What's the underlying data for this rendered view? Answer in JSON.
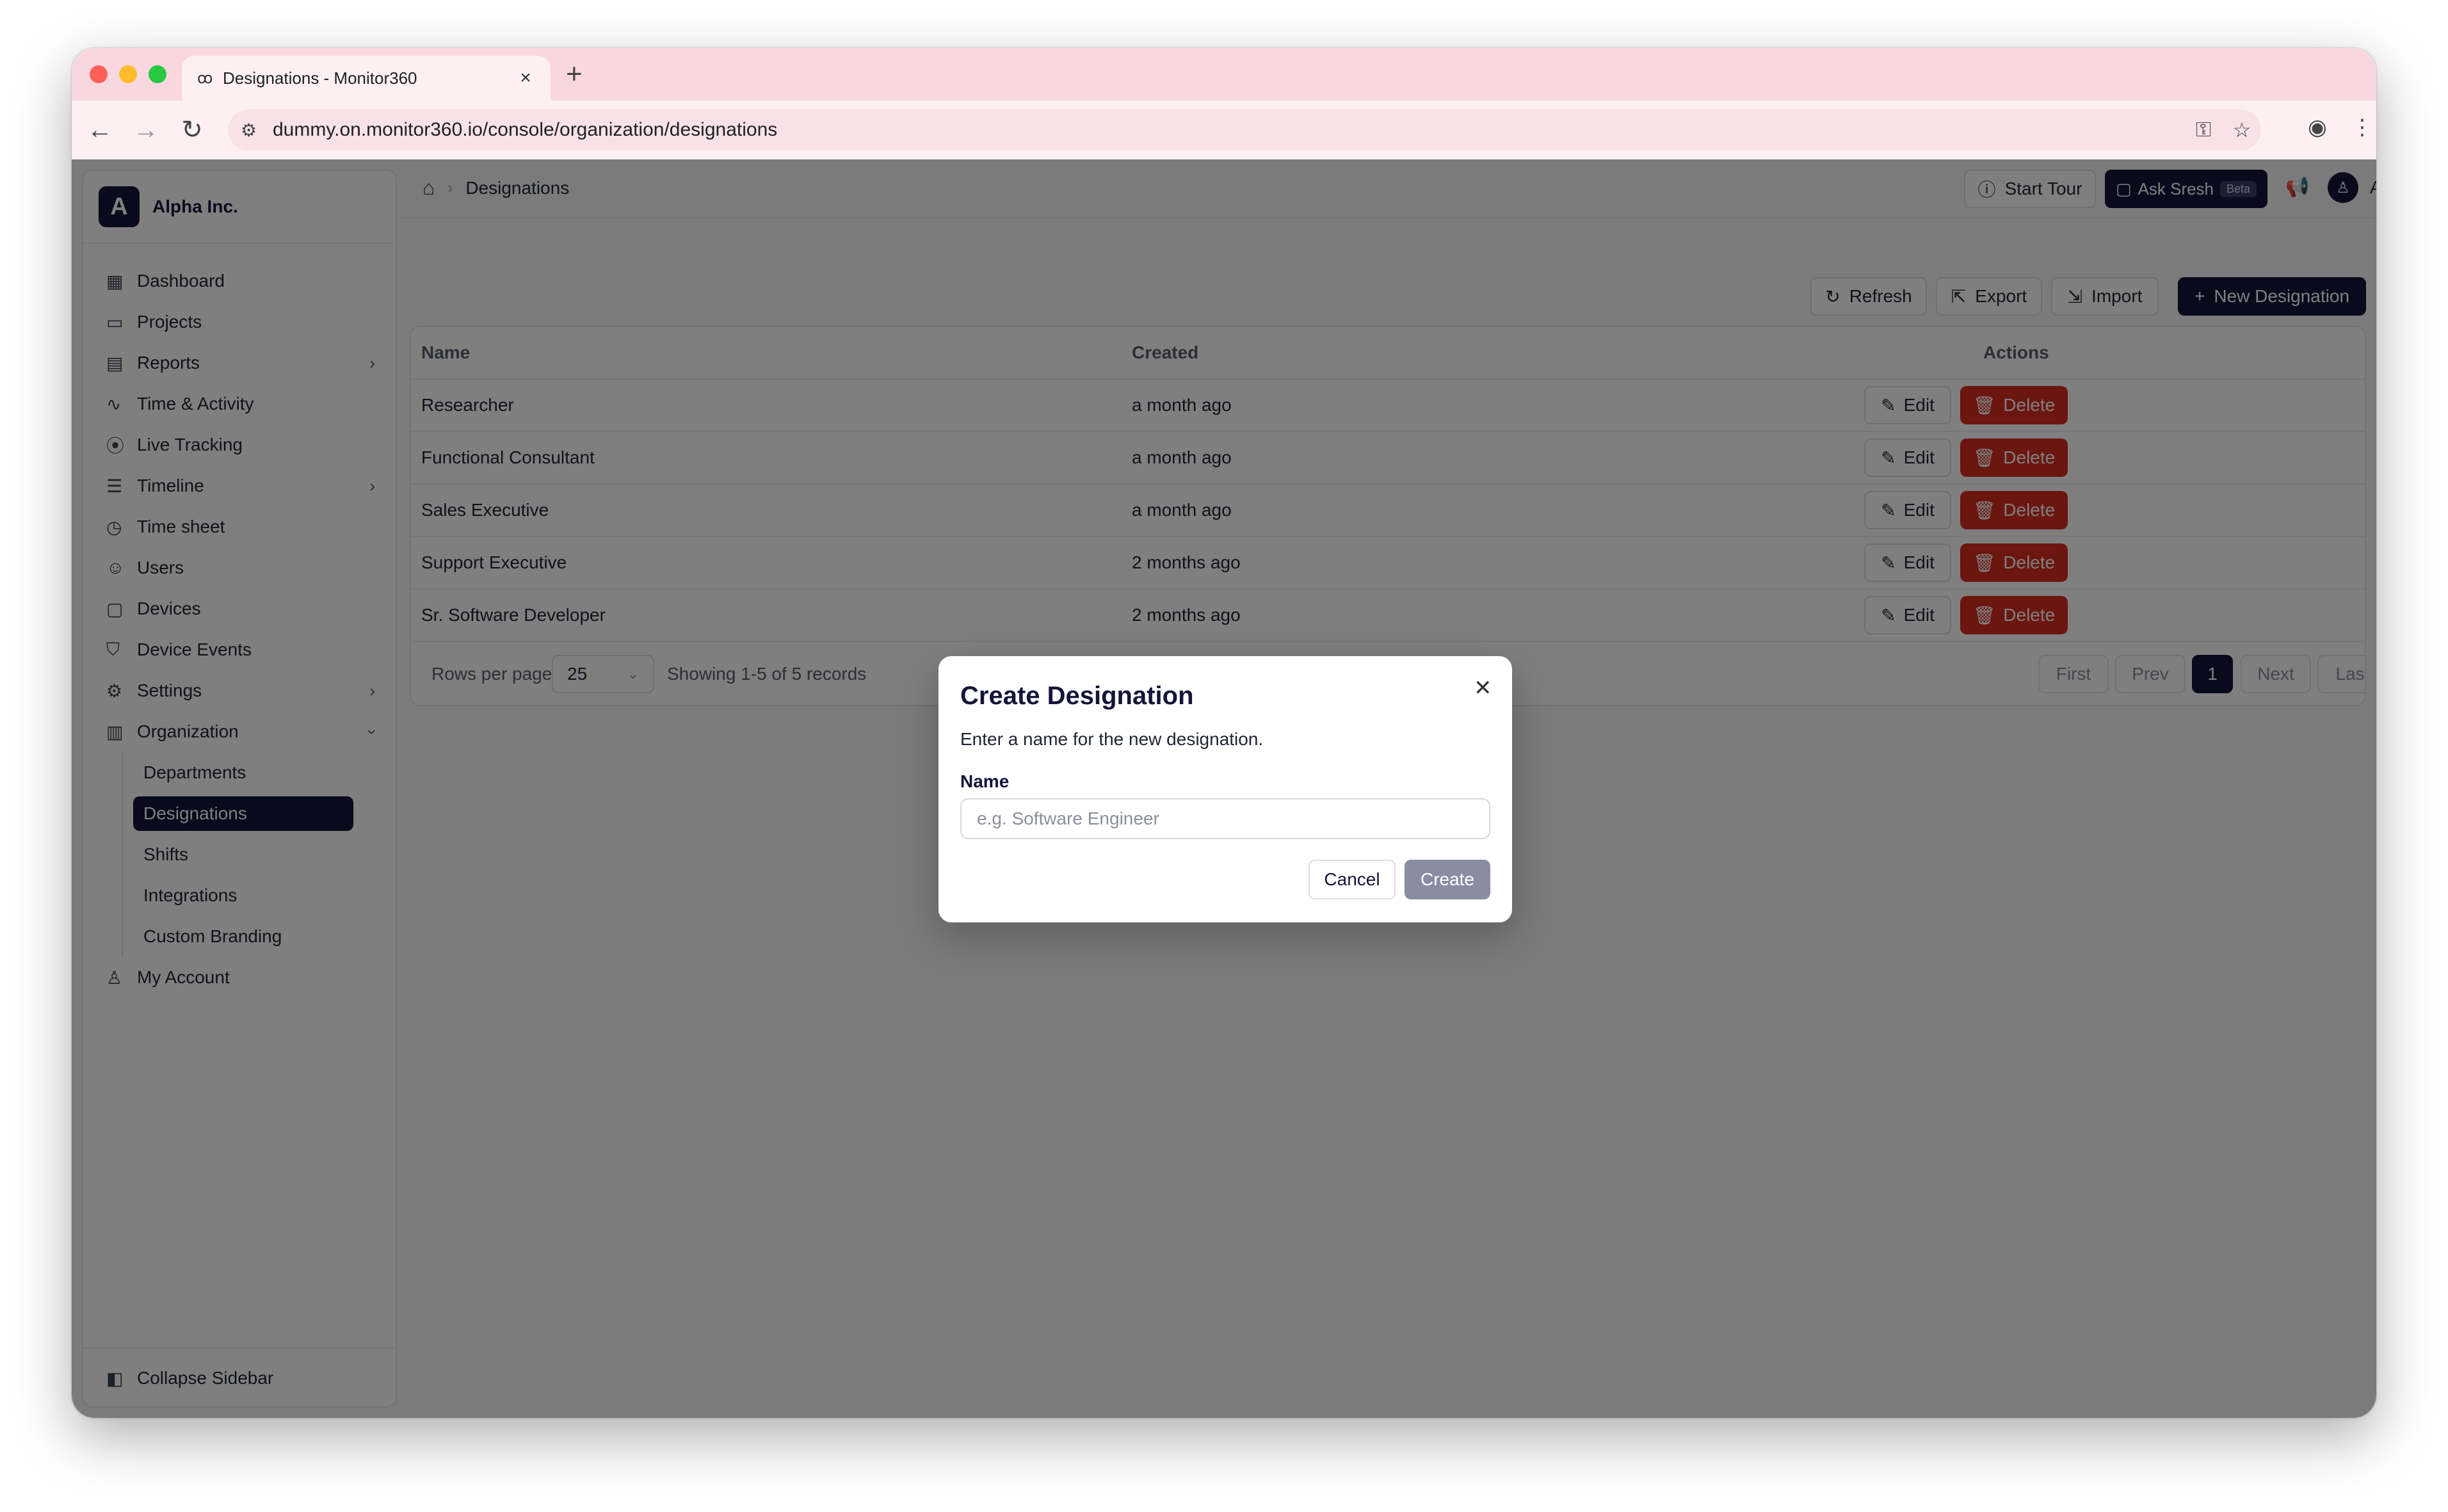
{
  "browser": {
    "tab_title": "Designations - Monitor360",
    "url": "dummy.on.monitor360.io/console/organization/designations"
  },
  "org": {
    "initial": "A",
    "name": "Alpha Inc."
  },
  "sidebar": {
    "items": [
      {
        "label": "Dashboard",
        "icon": "grid-icon"
      },
      {
        "label": "Projects",
        "icon": "folder-icon"
      },
      {
        "label": "Reports",
        "icon": "report-icon",
        "expandable": true
      },
      {
        "label": "Time & Activity",
        "icon": "activity-icon"
      },
      {
        "label": "Live Tracking",
        "icon": "radio-icon"
      },
      {
        "label": "Timeline",
        "icon": "timeline-icon",
        "expandable": true
      },
      {
        "label": "Time sheet",
        "icon": "timer-icon"
      },
      {
        "label": "Users",
        "icon": "users-icon"
      },
      {
        "label": "Devices",
        "icon": "monitor-icon"
      },
      {
        "label": "Device Events",
        "icon": "shield-icon"
      },
      {
        "label": "Settings",
        "icon": "gear-icon",
        "expandable": true
      },
      {
        "label": "Organization",
        "icon": "building-icon",
        "expanded": true
      }
    ],
    "org_sub_items": [
      "Departments",
      "Designations",
      "Shifts",
      "Integrations",
      "Custom Branding"
    ],
    "active_sub_item": "Designations",
    "my_account": "My Account",
    "collapse": "Collapse Sidebar"
  },
  "header": {
    "breadcrumb": "Designations",
    "start_tour": "Start Tour",
    "ask": "Ask Sresh",
    "beta": "Beta",
    "user": "Admin"
  },
  "toolbar": {
    "refresh": "Refresh",
    "export": "Export",
    "import": "Import",
    "new": "New Designation"
  },
  "table": {
    "columns": [
      "Name",
      "Created",
      "Actions"
    ],
    "rows": [
      {
        "name": "Researcher",
        "created": "a month ago"
      },
      {
        "name": "Functional Consultant",
        "created": "a month ago"
      },
      {
        "name": "Sales Executive",
        "created": "a month ago"
      },
      {
        "name": "Support Executive",
        "created": "2 months ago"
      },
      {
        "name": "Sr. Software Developer",
        "created": "2 months ago"
      }
    ],
    "edit_label": "Edit",
    "delete_label": "Delete"
  },
  "pagination": {
    "rows_per_page_label": "Rows per page",
    "rows_per_page": "25",
    "showing": "Showing 1-5 of 5 records",
    "first": "First",
    "prev": "Prev",
    "current": "1",
    "next": "Next",
    "last": "Last"
  },
  "modal": {
    "title": "Create Designation",
    "description": "Enter a name for the new designation.",
    "field_label": "Name",
    "placeholder": "e.g. Software Engineer",
    "value": "",
    "cancel": "Cancel",
    "create": "Create"
  },
  "colors": {
    "brand_dark": "#15153a",
    "danger": "#d92d20",
    "tab_bar": "#f8d7df"
  }
}
